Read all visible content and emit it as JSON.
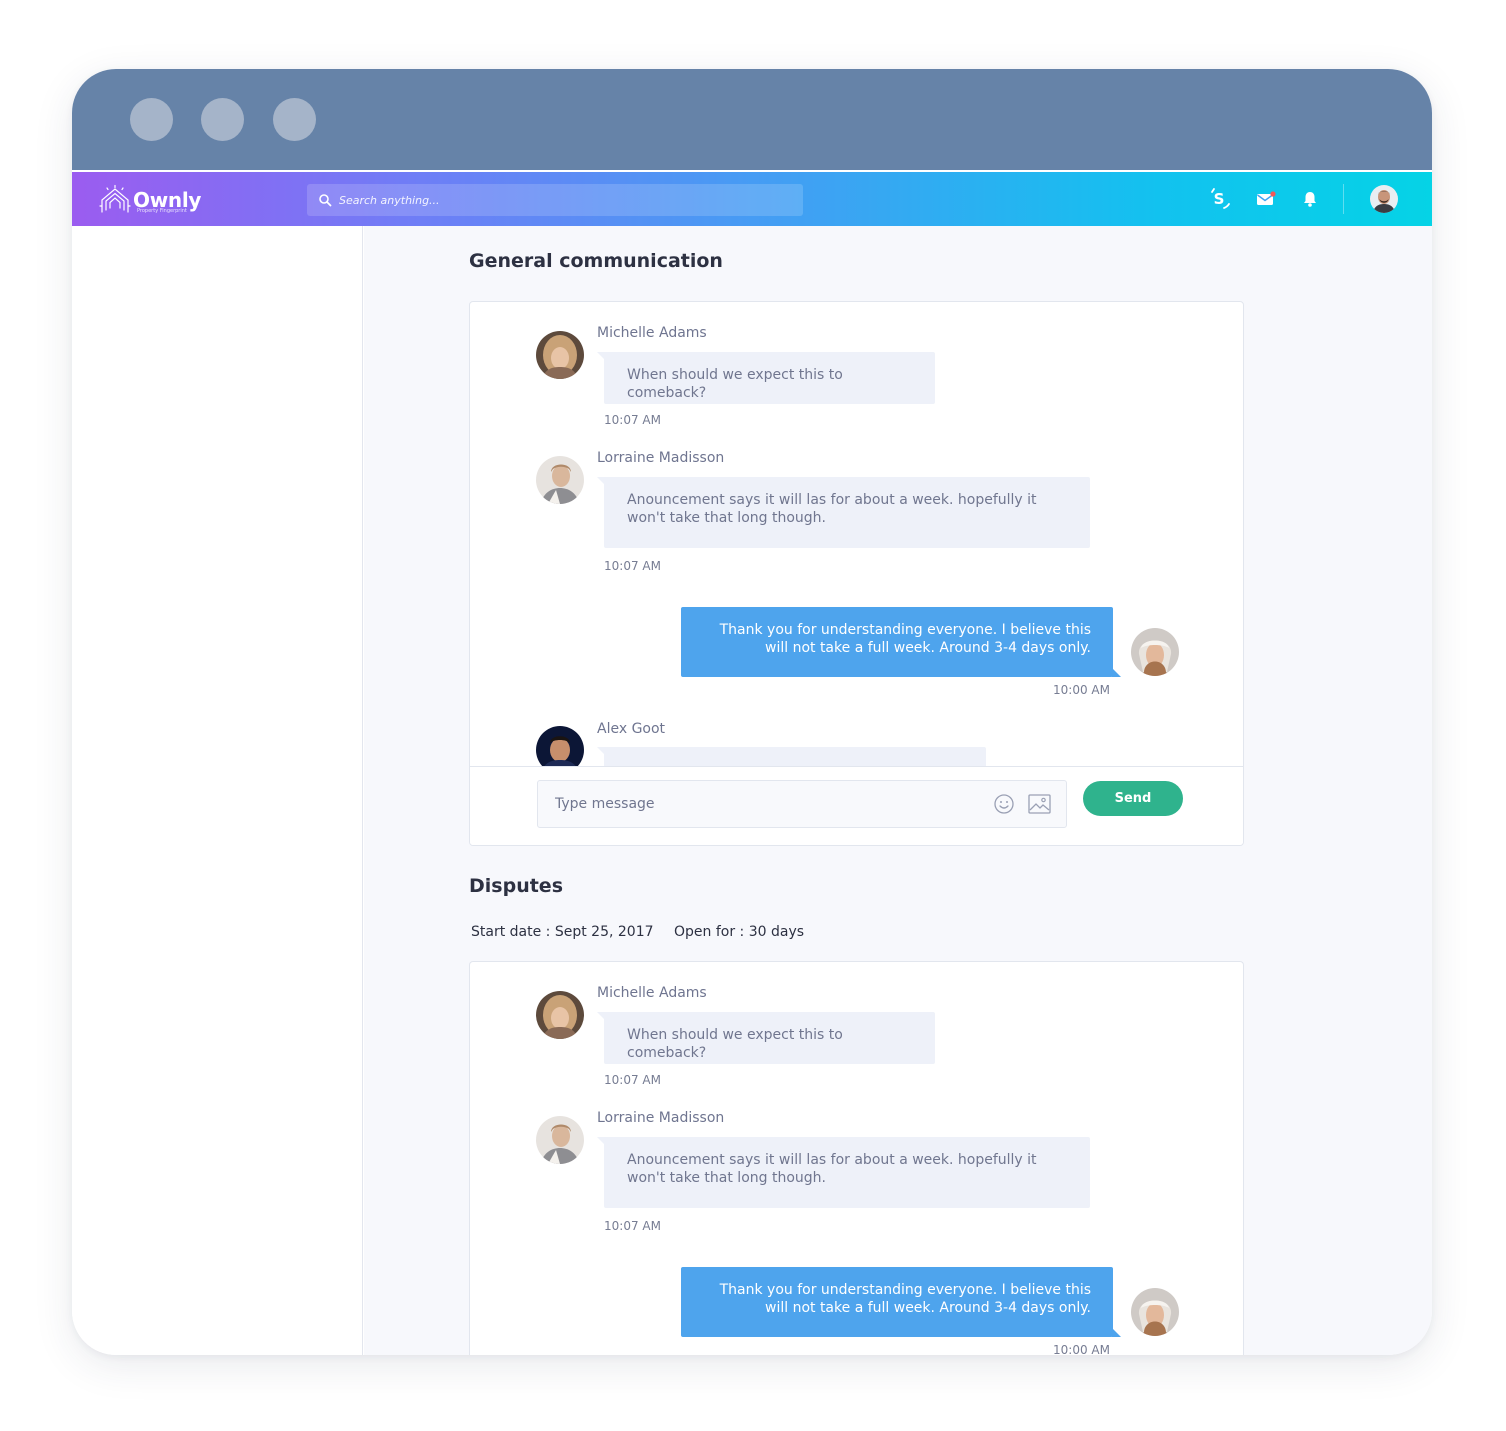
{
  "app": {
    "logo_text": "Ownly",
    "logo_tagline": "Property Fingerprint",
    "search_placeholder": "Search anything..."
  },
  "header_icons": [
    "sharesale-logo-icon",
    "mail-icon",
    "bell-icon",
    "user-avatar"
  ],
  "colors": {
    "titlebar": "#6683a8",
    "gradient_start": "#9b5cf0",
    "gradient_end": "#05d3e6",
    "outgoing_bubble": "#4ea4ed",
    "incoming_bubble": "#eef1f9",
    "send_button": "#2fb38d"
  },
  "general": {
    "title": "General communication",
    "messages": [
      {
        "sender": "Michelle Adams",
        "text": "When should we expect this to comeback?",
        "time": "10:07 AM"
      },
      {
        "sender": "Lorraine Madisson",
        "text": "Anouncement says it will las for about a week. hopefully it won't take that long though.",
        "time": "10:07 AM"
      },
      {
        "text": "Thank  you for understanding everyone. I believe this will not take a full week. Around 3-4 days only.",
        "time": "10:00 AM"
      },
      {
        "sender": "Alex Goot"
      }
    ],
    "composer_placeholder": "Type message",
    "send_label": "Send"
  },
  "disputes": {
    "title": "Disputes",
    "start_date": "Start date : Sept 25, 2017",
    "open_for": "Open for : 30 days",
    "messages": [
      {
        "sender": "Michelle Adams",
        "text": "When should we expect this to comeback?",
        "time": "10:07 AM"
      },
      {
        "sender": "Lorraine Madisson",
        "text": "Anouncement says it will las for about a week. hopefully it won't take that long though.",
        "time": "10:07 AM"
      },
      {
        "text": "Thank  you for understanding everyone. I believe this will not take a full week. Around 3-4 days only.",
        "time": "10:00 AM"
      }
    ]
  }
}
